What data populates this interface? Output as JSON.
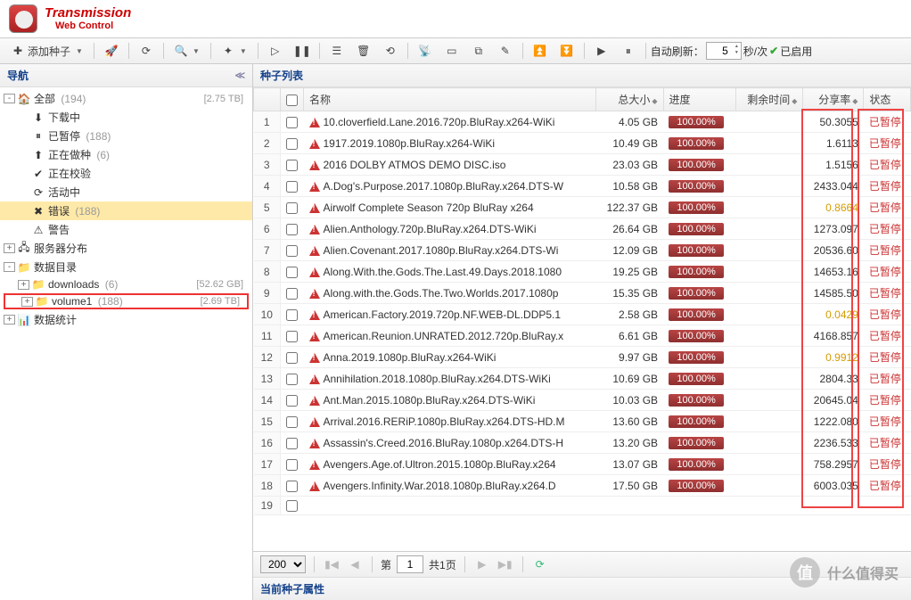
{
  "app": {
    "title": "Transmission",
    "subtitle": "Web Control"
  },
  "toolbar": {
    "add_seed": "添加种子",
    "auto_refresh_label": "自动刷新：",
    "refresh_value": "5",
    "refresh_unit": "秒/次",
    "enabled": "已启用"
  },
  "sidebar": {
    "title": "导航",
    "items": [
      {
        "exp": "-",
        "indent": 0,
        "icon": "home",
        "label": "全部",
        "count": "(194)",
        "right": "[2.75 TB]"
      },
      {
        "exp": "",
        "indent": 1,
        "icon": "download",
        "label": "下载中",
        "count": "",
        "right": ""
      },
      {
        "exp": "",
        "indent": 1,
        "icon": "pause",
        "label": "已暂停",
        "count": "(188)",
        "right": ""
      },
      {
        "exp": "",
        "indent": 1,
        "icon": "upload",
        "label": "正在做种",
        "count": "(6)",
        "right": ""
      },
      {
        "exp": "",
        "indent": 1,
        "icon": "check",
        "label": "正在校验",
        "count": "",
        "right": ""
      },
      {
        "exp": "",
        "indent": 1,
        "icon": "activity",
        "label": "活动中",
        "count": "",
        "right": ""
      },
      {
        "exp": "",
        "indent": 1,
        "icon": "error",
        "label": "错误",
        "count": "(188)",
        "right": "",
        "selected": true
      },
      {
        "exp": "",
        "indent": 1,
        "icon": "warn",
        "label": "警告",
        "count": "",
        "right": ""
      },
      {
        "exp": "+",
        "indent": 0,
        "icon": "server",
        "label": "服务器分布",
        "count": "",
        "right": ""
      },
      {
        "exp": "-",
        "indent": 0,
        "icon": "folder",
        "label": "数据目录",
        "count": "",
        "right": ""
      },
      {
        "exp": "+",
        "indent": 1,
        "icon": "folder",
        "label": "downloads",
        "count": "(6)",
        "right": "[52.62 GB]"
      },
      {
        "exp": "+",
        "indent": 1,
        "icon": "folder",
        "label": "volume1",
        "count": "(188)",
        "right": "[2.69 TB]",
        "boxed": true
      },
      {
        "exp": "+",
        "indent": 0,
        "icon": "stats",
        "label": "数据统计",
        "count": "",
        "right": ""
      }
    ]
  },
  "list": {
    "title": "种子列表",
    "columns": {
      "name": "名称",
      "size": "总大小",
      "progress": "进度",
      "remaining": "剩余时间",
      "ratio": "分享率",
      "status": "状态"
    },
    "rows": [
      {
        "n": 1,
        "name": "10.cloverfield.Lane.2016.720p.BluRay.x264-WiKi",
        "size": "4.05 GB",
        "prog": "100.00%",
        "ratio": "50.3055",
        "status": "已暂停"
      },
      {
        "n": 2,
        "name": "1917.2019.1080p.BluRay.x264-WiKi",
        "size": "10.49 GB",
        "prog": "100.00%",
        "ratio": "1.6113",
        "status": "已暂停"
      },
      {
        "n": 3,
        "name": "2016 DOLBY ATMOS DEMO DISC.iso",
        "size": "23.03 GB",
        "prog": "100.00%",
        "ratio": "1.5156",
        "status": "已暂停"
      },
      {
        "n": 4,
        "name": "A.Dog's.Purpose.2017.1080p.BluRay.x264.DTS-W",
        "size": "10.58 GB",
        "prog": "100.00%",
        "ratio": "2433.044",
        "status": "已暂停"
      },
      {
        "n": 5,
        "name": "Airwolf Complete Season 720p BluRay x264",
        "size": "122.37 GB",
        "prog": "100.00%",
        "ratio": "0.8664",
        "gold": true,
        "status": "已暂停"
      },
      {
        "n": 6,
        "name": "Alien.Anthology.720p.BluRay.x264.DTS-WiKi",
        "size": "26.64 GB",
        "prog": "100.00%",
        "ratio": "1273.097",
        "status": "已暂停"
      },
      {
        "n": 7,
        "name": "Alien.Covenant.2017.1080p.BluRay.x264.DTS-Wi",
        "size": "12.09 GB",
        "prog": "100.00%",
        "ratio": "20536.60",
        "status": "已暂停"
      },
      {
        "n": 8,
        "name": "Along.With.the.Gods.The.Last.49.Days.2018.1080",
        "size": "19.25 GB",
        "prog": "100.00%",
        "ratio": "14653.16",
        "status": "已暂停"
      },
      {
        "n": 9,
        "name": "Along.with.the.Gods.The.Two.Worlds.2017.1080p",
        "size": "15.35 GB",
        "prog": "100.00%",
        "ratio": "14585.50",
        "status": "已暂停"
      },
      {
        "n": 10,
        "name": "American.Factory.2019.720p.NF.WEB-DL.DDP5.1",
        "size": "2.58 GB",
        "prog": "100.00%",
        "ratio": "0.0429",
        "gold": true,
        "status": "已暂停"
      },
      {
        "n": 11,
        "name": "American.Reunion.UNRATED.2012.720p.BluRay.x",
        "size": "6.61 GB",
        "prog": "100.00%",
        "ratio": "4168.857",
        "status": "已暂停"
      },
      {
        "n": 12,
        "name": "Anna.2019.1080p.BluRay.x264-WiKi",
        "size": "9.97 GB",
        "prog": "100.00%",
        "ratio": "0.9912",
        "gold": true,
        "status": "已暂停"
      },
      {
        "n": 13,
        "name": "Annihilation.2018.1080p.BluRay.x264.DTS-WiKi",
        "size": "10.69 GB",
        "prog": "100.00%",
        "ratio": "2804.33",
        "status": "已暂停"
      },
      {
        "n": 14,
        "name": "Ant.Man.2015.1080p.BluRay.x264.DTS-WiKi",
        "size": "10.03 GB",
        "prog": "100.00%",
        "ratio": "20645.04",
        "status": "已暂停"
      },
      {
        "n": 15,
        "name": "Arrival.2016.RERiP.1080p.BluRay.x264.DTS-HD.M",
        "size": "13.60 GB",
        "prog": "100.00%",
        "ratio": "1222.080",
        "status": "已暂停"
      },
      {
        "n": 16,
        "name": "Assassin's.Creed.2016.BluRay.1080p.x264.DTS-H",
        "size": "13.20 GB",
        "prog": "100.00%",
        "ratio": "2236.533",
        "status": "已暂停"
      },
      {
        "n": 17,
        "name": "Avengers.Age.of.Ultron.2015.1080p.BluRay.x264",
        "size": "13.07 GB",
        "prog": "100.00%",
        "ratio": "758.2957",
        "status": "已暂停"
      },
      {
        "n": 18,
        "name": "Avengers.Infinity.War.2018.1080p.BluRay.x264.D",
        "size": "17.50 GB",
        "prog": "100.00%",
        "ratio": "6003.035",
        "status": "已暂停"
      }
    ],
    "last_row_num": 19
  },
  "pager": {
    "page_size": "200",
    "page_label_prefix": "第",
    "page_value": "1",
    "total_pages": "共1页"
  },
  "footer": {
    "properties": "当前种子属性"
  },
  "watermark": {
    "symbol": "值",
    "text": "什么值得买"
  }
}
